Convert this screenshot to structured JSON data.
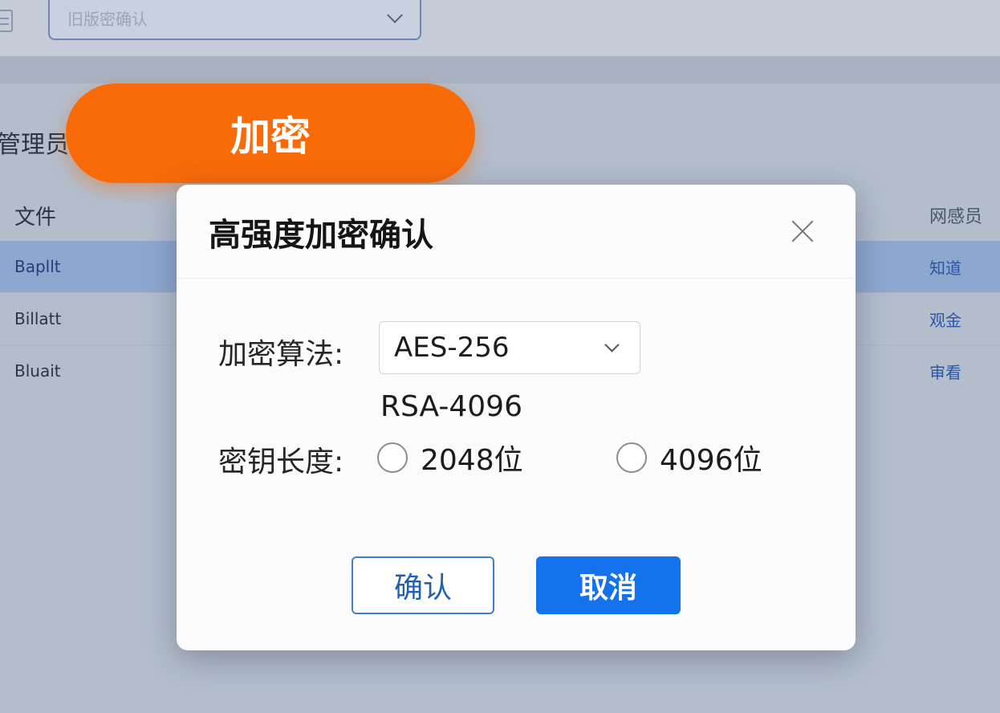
{
  "background": {
    "top_select_text": "旧版密确认",
    "admin_label": "管理员",
    "encrypt_button_label": "加密",
    "table": {
      "col_file": "文件",
      "col_right": "网感员",
      "rows": [
        {
          "name": "Bapllt",
          "value": "知道",
          "selected": true
        },
        {
          "name": "Billatt",
          "value": "观金",
          "selected": false
        },
        {
          "name": "Bluait",
          "value": "审看",
          "selected": false
        }
      ]
    }
  },
  "modal": {
    "title": "高强度加密确认",
    "algorithm_label": "加密算法:",
    "algorithm_selected": "AES-256",
    "algorithm_option_visible": "RSA-4096",
    "key_length_label": "密钥长度:",
    "key_options": [
      {
        "label": "2048位",
        "checked": false
      },
      {
        "label": "4096位",
        "checked": false
      }
    ],
    "confirm_label": "确认",
    "cancel_label": "取消"
  },
  "colors": {
    "accent_orange": "#f96a08",
    "primary_blue": "#1473ec",
    "selected_row": "#8ea7cf"
  },
  "icons": [
    "document-icon",
    "chevron-down-icon",
    "close-icon",
    "radio-icon"
  ]
}
